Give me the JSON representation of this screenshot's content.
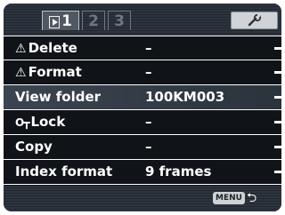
{
  "tabs": [
    {
      "label": "1",
      "icon": "playback-icon",
      "active": true
    },
    {
      "label": "2",
      "active": false
    },
    {
      "label": "3",
      "active": false
    }
  ],
  "setup_tab_icon": "wrench-icon",
  "menu": {
    "items": [
      {
        "label": "Delete",
        "value": "–",
        "icon": "warning-icon"
      },
      {
        "label": "Format",
        "value": "–",
        "icon": "warning-icon"
      },
      {
        "label": "View folder",
        "value": "100KM003"
      },
      {
        "label": "Lock",
        "value": "–",
        "icon": "key-icon"
      },
      {
        "label": "Copy",
        "value": "–"
      },
      {
        "label": "Index format",
        "value": "9 frames"
      }
    ]
  },
  "footer": {
    "menu_label": "MENU",
    "return_icon": "return-icon"
  }
}
